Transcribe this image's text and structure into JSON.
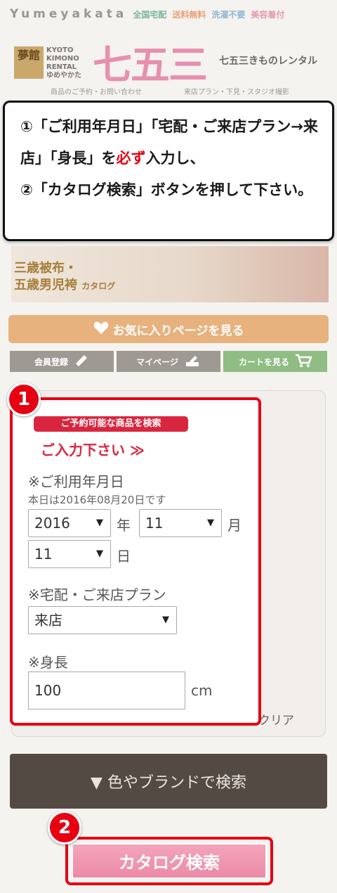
{
  "header": {
    "brand": "Yumeyakata",
    "tags": [
      "全国宅配",
      "送料無料",
      "洗濯不要",
      "美容着付"
    ],
    "logo_box": "夢館",
    "logo_text": [
      "KYOTO",
      "KIMONO",
      "RENTAL",
      "ゆめやかた"
    ],
    "logo_big": "七五三",
    "logo_sub": "七五三きものレンタル",
    "sub_left": "商品のご予約・お問い合わせ",
    "sub_right": "来店プラン・下見・スタジオ撮影"
  },
  "instructions": {
    "line1_a": "①「ご利用年月日」「宅配・ご来店プラン→来店」「身長」を",
    "line1_em": "必ず",
    "line1_b": "入力し、",
    "line2": "②「カタログ検索」ボタンを押して下さい。"
  },
  "banner": {
    "line1": "三歳被布・",
    "line2": "五歳男児袴",
    "small": "カタログ"
  },
  "buttons": {
    "favorites": "お気に入りページを見る",
    "register": "会員登録",
    "mypage": "マイページ",
    "cart": "カートを見る",
    "brand_search": "▼ 色やブランドで検索",
    "catalog_search": "カタログ検索",
    "clear": "利用条件クリア"
  },
  "form": {
    "pill": "ご予約可能な商品を検索",
    "pill_sub": "ご入力下さい ≫",
    "date_label": "※ご利用年月日",
    "today": "本日は2016年08月20日です",
    "year": "2016",
    "year_unit": "年",
    "month": "11",
    "month_unit": "月",
    "day": "11",
    "day_unit": "日",
    "plan_label": "※宅配・ご来店プラン",
    "plan": "来店",
    "height_label": "※身長",
    "height": "100",
    "height_unit": "cm"
  },
  "badges": {
    "one": "1",
    "two": "2"
  },
  "colors": {
    "highlight": "#e60012",
    "catalog_button": "#ec8aa7",
    "favorites_button": "#e7b27e"
  }
}
